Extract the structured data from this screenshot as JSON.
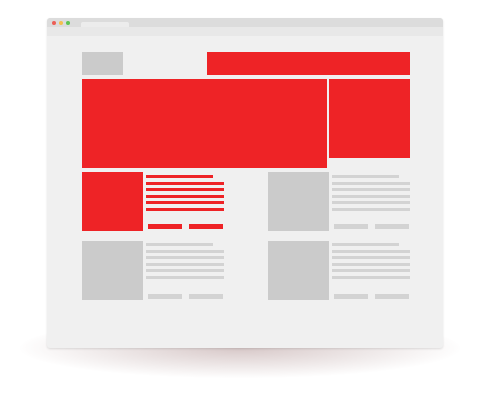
{
  "window": {
    "title_dots": [
      {
        "icon": "close-dot-icon",
        "color": "#ec5f57"
      },
      {
        "icon": "minimize-dot-icon",
        "color": "#f4bf4f"
      },
      {
        "icon": "maximize-dot-icon",
        "color": "#5fc553"
      }
    ]
  },
  "colors": {
    "accent": "#ee2326",
    "placeholder": "#cbcbcb",
    "text_line": "#d3d3d3",
    "page_background": "#f0f0f0"
  },
  "cards": [
    {
      "theme": "accent",
      "lines": 6,
      "buttons": 2
    },
    {
      "theme": "neutral",
      "lines": 6,
      "buttons": 2
    },
    {
      "theme": "neutral",
      "lines": 6,
      "buttons": 2
    },
    {
      "theme": "neutral",
      "lines": 6,
      "buttons": 2
    }
  ]
}
